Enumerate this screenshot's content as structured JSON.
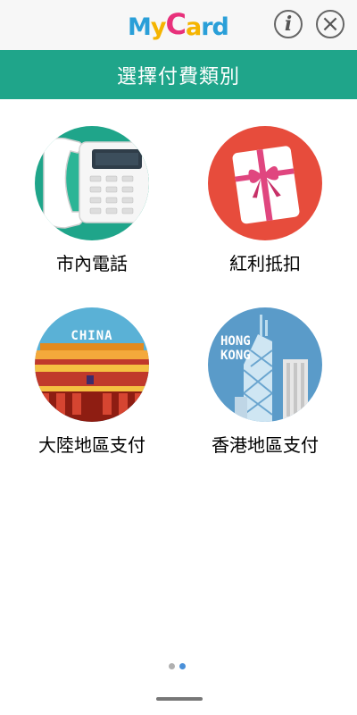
{
  "app": {
    "logo_letters": [
      "M",
      "y",
      "C",
      "a",
      "r",
      "d"
    ],
    "logo_colors": [
      "#2a9fd8",
      "#f5b400",
      "#e8317b",
      "#f5b400",
      "#2a9fd8",
      "#2a9fd8"
    ]
  },
  "header": {
    "title": "選擇付費類別"
  },
  "categories": [
    {
      "label": "市內電話",
      "icon": "telephone-icon"
    },
    {
      "label": "紅利抵扣",
      "icon": "gift-icon"
    },
    {
      "label": "大陸地區支付",
      "icon": "china-palace-icon",
      "badge": "CHINA"
    },
    {
      "label": "香港地區支付",
      "icon": "hongkong-skyline-icon",
      "badge_line1": "HONG",
      "badge_line2": "KONG"
    }
  ],
  "pager": {
    "pages": 2,
    "current": 2,
    "inactive_color": "#b0b0b0",
    "active_color": "#4a90d9"
  },
  "colors": {
    "accent": "#1fa58a",
    "phone_bg": "#1fa58a",
    "gift_bg": "#e74c3c",
    "china_bg": "#5ab1d6",
    "hk_bg": "#5a9bc9"
  }
}
